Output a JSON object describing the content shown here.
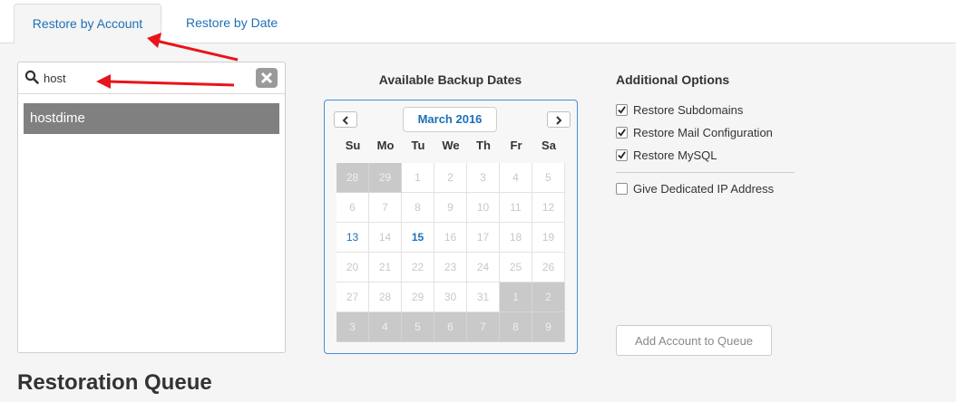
{
  "tabs": [
    {
      "label": "Restore by Account",
      "active": true
    },
    {
      "label": "Restore by Date",
      "active": false
    }
  ],
  "search": {
    "value": "host",
    "icon": "search-icon"
  },
  "accounts": [
    "hostdime"
  ],
  "calendar": {
    "title": "Available Backup Dates",
    "month_label": "March 2016",
    "weekdays": [
      "Su",
      "Mo",
      "Tu",
      "We",
      "Th",
      "Fr",
      "Sa"
    ],
    "weeks": [
      [
        "28",
        "29",
        "1",
        "2",
        "3",
        "4",
        "5"
      ],
      [
        "6",
        "7",
        "8",
        "9",
        "10",
        "11",
        "12"
      ],
      [
        "13",
        "14",
        "15",
        "16",
        "17",
        "18",
        "19"
      ],
      [
        "20",
        "21",
        "22",
        "23",
        "24",
        "25",
        "26"
      ],
      [
        "27",
        "28",
        "29",
        "30",
        "31",
        "1",
        "2"
      ],
      [
        "3",
        "4",
        "5",
        "6",
        "7",
        "8",
        "9"
      ]
    ],
    "available_days": [
      "13",
      "15"
    ],
    "selected_day": "15"
  },
  "options": {
    "title": "Additional Options",
    "items": [
      {
        "label": "Restore Subdomains",
        "checked": true
      },
      {
        "label": "Restore Mail Configuration",
        "checked": true
      },
      {
        "label": "Restore MySQL",
        "checked": true
      },
      {
        "label": "Give Dedicated IP Address",
        "checked": false
      }
    ],
    "queue_button": "Add Account to Queue"
  },
  "queue": {
    "title": "Restoration Queue"
  },
  "colors": {
    "accent": "#1e6fb8",
    "annotation_arrow": "#e8141a",
    "selected_row": "#808080"
  }
}
